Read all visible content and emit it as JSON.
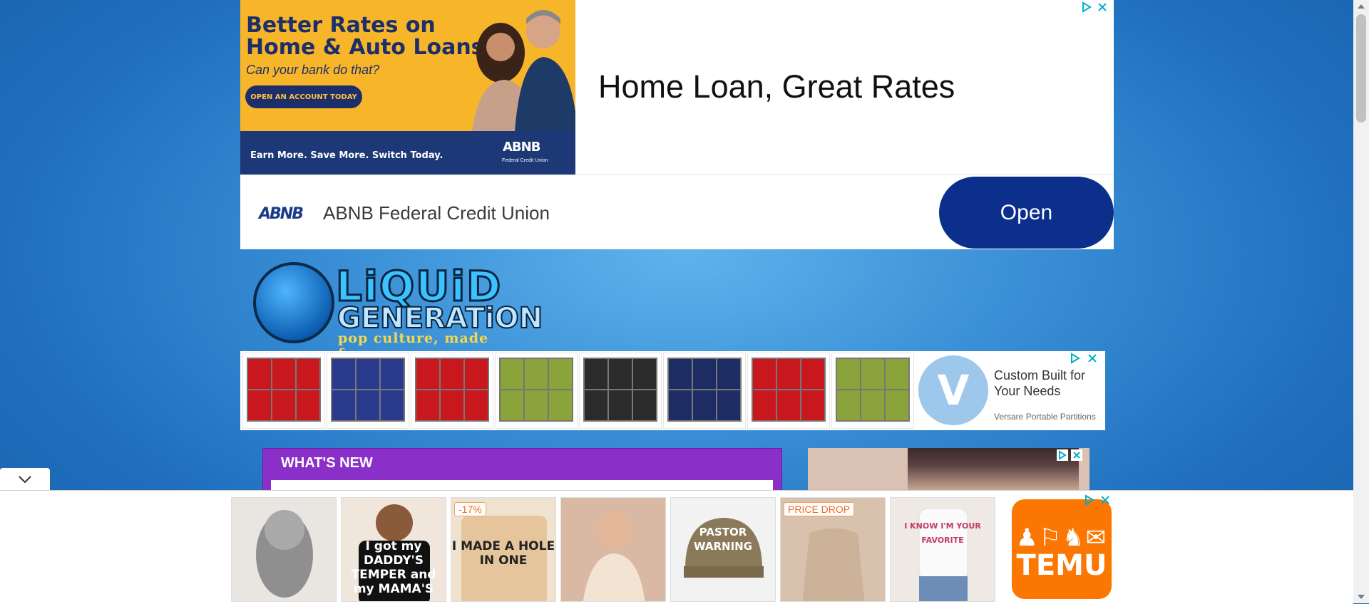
{
  "top_ad": {
    "banner_headline_line1": "Better Rates on",
    "banner_headline_line2": "Home & Auto Loans",
    "banner_subtitle": "Can your bank do that?",
    "banner_cta": "OPEN AN ACCOUNT TODAY",
    "banner_footer_tagline": "Earn More. Save More. Switch Today.",
    "banner_logo": "ABNB",
    "banner_logo_sub": "Federal Credit Union",
    "headline": "Home Loan, Great Rates",
    "advertiser_logo": "ABNB",
    "advertiser_name": "ABNB Federal Credit Union",
    "open_label": "Open"
  },
  "site_logo": {
    "line1": "LiQUiD",
    "line2": "GENERATiON",
    "tagline": "pop culture, made funny."
  },
  "partition_ad": {
    "swatches": [
      "#c8181e",
      "#2a3a8c",
      "#c8181e",
      "#8aa33a",
      "#2b2b2b",
      "#1d2d63",
      "#c8181e",
      "#8aa33a"
    ],
    "logo_letter": "V",
    "headline": "Custom Built for Your Needs",
    "advertiser": "Versare Portable Partitions"
  },
  "whats_new": {
    "title": "WHAT'S NEW"
  },
  "bottom_ad": {
    "products": [
      {
        "name": "cat-face-mask",
        "badge": "",
        "text": ""
      },
      {
        "name": "kids-tshirt",
        "badge": "",
        "text": "I got my DADDY'S TEMPER and my MAMA'S"
      },
      {
        "name": "hole-in-one-tshirt",
        "badge": "-17%",
        "text": "I MADE A HOLE IN ONE"
      },
      {
        "name": "woman-camisole",
        "badge": "",
        "text": ""
      },
      {
        "name": "pastor-cap",
        "badge": "",
        "text": "PASTOR WARNING"
      },
      {
        "name": "knit-halter-top",
        "badge": "PRICE DROP",
        "text": ""
      },
      {
        "name": "white-crop-top",
        "badge": "",
        "text": "I KNOW I'M YOUR FAVORITE"
      }
    ],
    "brand": "TEMU"
  },
  "colors": {
    "ad_navy": "#0b2f8a",
    "whats_new_purple": "#8b2fc9",
    "temu_orange": "#fb7701",
    "banner_yellow": "#f7b529"
  }
}
